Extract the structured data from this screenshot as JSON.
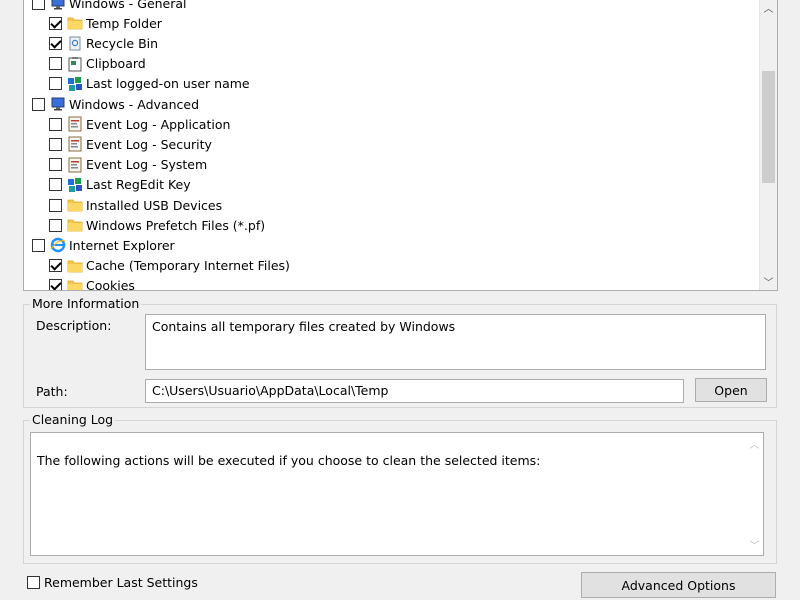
{
  "tree": {
    "items": [
      {
        "label": "Windows - General",
        "checked": false,
        "level": 0,
        "icon": "computer-icon"
      },
      {
        "label": "Temp Folder",
        "checked": true,
        "level": 1,
        "icon": "folder-icon"
      },
      {
        "label": "Recycle Bin",
        "checked": true,
        "level": 1,
        "icon": "recycle-bin-icon"
      },
      {
        "label": "Clipboard",
        "checked": false,
        "level": 1,
        "icon": "clipboard-icon"
      },
      {
        "label": "Last logged-on user name",
        "checked": false,
        "level": 1,
        "icon": "registry-icon"
      },
      {
        "label": "Windows - Advanced",
        "checked": false,
        "level": 0,
        "icon": "computer-icon"
      },
      {
        "label": "Event Log - Application",
        "checked": false,
        "level": 1,
        "icon": "event-log-icon"
      },
      {
        "label": "Event Log - Security",
        "checked": false,
        "level": 1,
        "icon": "event-log-icon"
      },
      {
        "label": "Event Log - System",
        "checked": false,
        "level": 1,
        "icon": "event-log-icon"
      },
      {
        "label": "Last RegEdit Key",
        "checked": false,
        "level": 1,
        "icon": "registry-icon"
      },
      {
        "label": "Installed USB Devices",
        "checked": false,
        "level": 1,
        "icon": "folder-icon"
      },
      {
        "label": "Windows Prefetch Files (*.pf)",
        "checked": false,
        "level": 1,
        "icon": "folder-icon"
      },
      {
        "label": "Internet Explorer",
        "checked": false,
        "level": 0,
        "icon": "internet-explorer-icon"
      },
      {
        "label": "Cache (Temporary Internet Files)",
        "checked": true,
        "level": 1,
        "icon": "folder-icon"
      },
      {
        "label": "Cookies",
        "checked": true,
        "level": 1,
        "icon": "folder-icon"
      }
    ]
  },
  "more_info": {
    "title": "More Information",
    "description_label": "Description:",
    "description_value": "Contains all temporary files created by Windows",
    "path_label": "Path:",
    "path_value": "C:\\Users\\Usuario\\AppData\\Local\\Temp",
    "open_button": "Open"
  },
  "cleaning_log": {
    "title": "Cleaning Log",
    "text": "The following actions will be executed if you choose to clean the selected items:"
  },
  "footer": {
    "remember_label": "Remember Last Settings",
    "remember_checked": false,
    "advanced_button": "Advanced Options"
  }
}
